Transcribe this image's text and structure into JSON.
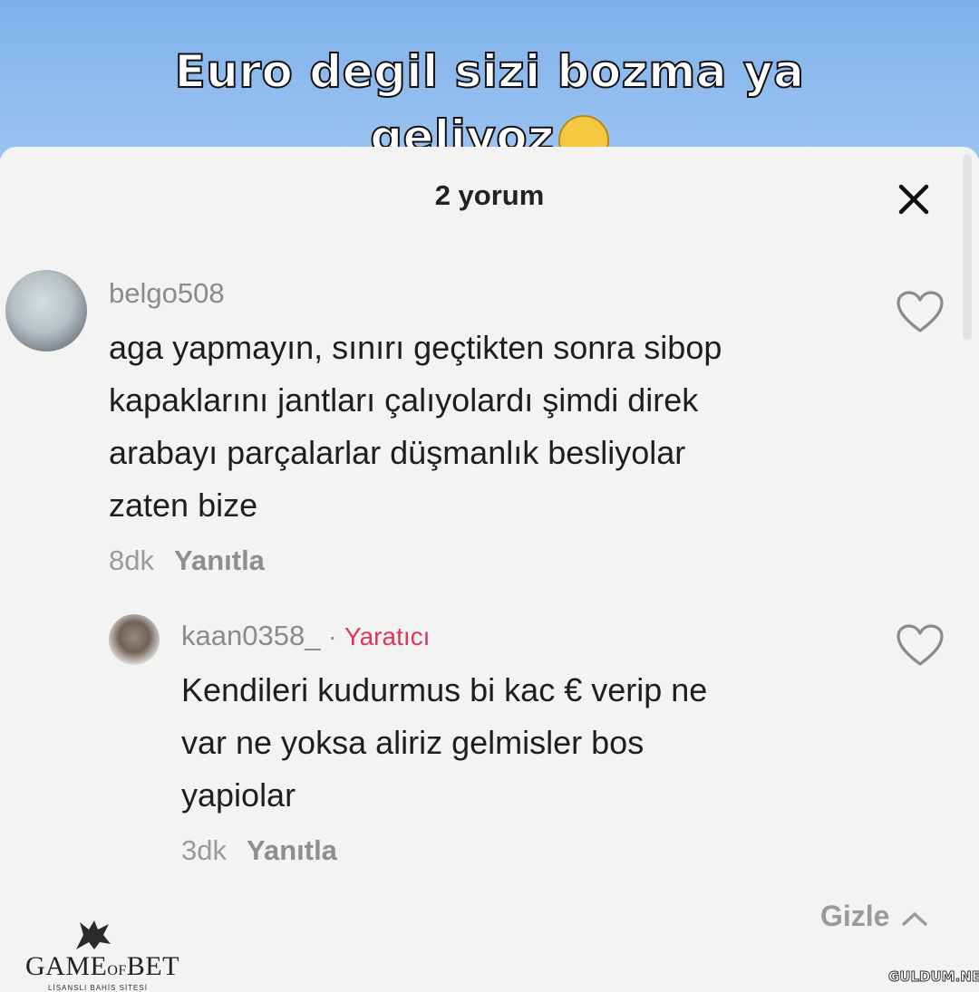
{
  "video": {
    "caption_line1": "Euro degil sizi bozma ya",
    "caption_line2": "geliyoz"
  },
  "sheet": {
    "comment_count": "2 yorum",
    "close_icon": "close-icon"
  },
  "comments": [
    {
      "username": "belgo508",
      "text": "aga yapmayın, sınırı geçtikten sonra sibop kapaklarını jantları çalıyolardı şimdi direk arabayı parçalarlar düşmanlık besliyolar zaten bize",
      "lines": [
        "aga yapmayın, sınırı geçtikten sonra sibop",
        "kapaklarını jantları çalıyolardı şimdi direk",
        "arabayı parçalarlar düşmanlık besliyolar",
        "zaten bize"
      ],
      "time": "8dk",
      "reply_label": "Yanıtla"
    },
    {
      "username": "kaan0358_",
      "separator": "·",
      "badge": "Yaratıcı",
      "lines": [
        "Kendileri kudurmus bi kac € verip ne",
        "var ne yoksa aliriz gelmisler bos",
        "yapiolar"
      ],
      "time": "3dk",
      "reply_label": "Yanıtla"
    }
  ],
  "hide_label": "Gizle",
  "logo": {
    "name_left": "GAME",
    "name_mid": "OF",
    "name_right": "BET",
    "tagline": "LİSANSLI BAHİS SİTESİ"
  },
  "watermark": "GULDUM.NET",
  "colors": {
    "creator_badge": "#e0355d",
    "sheet_bg": "#f3f3f3",
    "video_sky": "#8fbbee"
  }
}
